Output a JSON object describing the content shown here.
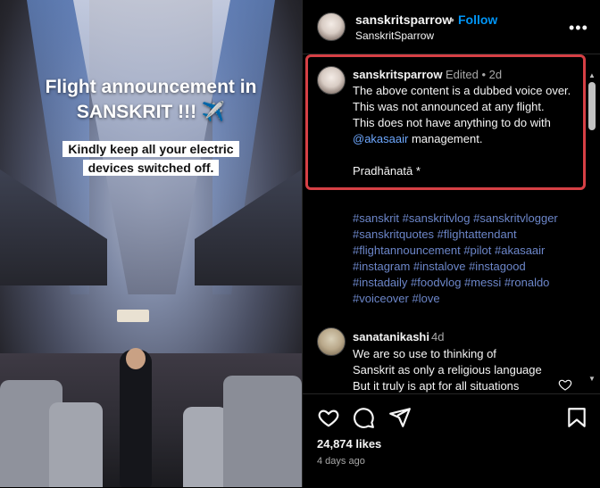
{
  "media": {
    "headline": "Flight announcement in SANSKRIT !!! ✈️",
    "subtitle": "Kindly keep all your  electric devices switched off."
  },
  "header": {
    "username": "sanskritsparrow",
    "dot": "•",
    "follow_label": "Follow",
    "subtitle": "SanskritSparrow",
    "more_label": "•••"
  },
  "caption": {
    "username": "sanskritsparrow",
    "meta": "Edited •  2d",
    "line1": "The above content is a dubbed voice over. This was not announced at any flight.",
    "line2_prefix": "This does not have anything to do with ",
    "mention": "@akasaair",
    "line2_suffix": " management.",
    "line3": "Pradhānatā *",
    "hashtags": "#sanskrit #sanskritvlog #sanskritvlogger #sanskritquotes #flightattendant #flightannouncement #pilot #akasaair #instagram #instalove #instagood #instadaily #foodvlog #messi #ronaldo #voiceover #love"
  },
  "comment": {
    "username": "sanatanikashi",
    "time": "4d",
    "text": "We are so use to thinking of\nSanskrit as only a religious language\nBut it truly is apt for all situations"
  },
  "footer": {
    "likes": "24,874 likes",
    "ago": "4 days ago"
  },
  "icons": [
    "heart-icon",
    "comment-icon",
    "share-icon",
    "bookmark-icon",
    "more-icon"
  ],
  "colors": {
    "accent": "#0095f6",
    "highlight_border": "#d64045",
    "hashtag": "#6c86c9"
  }
}
